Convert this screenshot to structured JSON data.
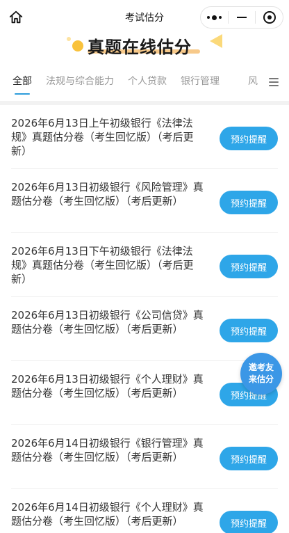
{
  "nav": {
    "title": "考试估分",
    "icons": [
      "home-icon",
      "more-icon",
      "minimize-icon",
      "target-icon"
    ]
  },
  "banner": {
    "title": "真题在线估分"
  },
  "tabs": [
    {
      "label": "全部",
      "active": true
    },
    {
      "label": "法规与综合能力",
      "active": false
    },
    {
      "label": "个人贷款",
      "active": false
    },
    {
      "label": "银行管理",
      "active": false
    },
    {
      "label": "风",
      "active": false
    }
  ],
  "items": [
    {
      "title": "2026年6月13日上午初级银行《法律法规》真题估分卷（考生回忆版）（考后更新）",
      "button": "预约提醒"
    },
    {
      "title": "2026年6月13日初级银行《风险管理》真题估分卷（考生回忆版）（考后更新）",
      "button": "预约提醒"
    },
    {
      "title": "2026年6月13日下午初级银行《法律法规》真题估分卷（考生回忆版）（考后更新）",
      "button": "预约提醒"
    },
    {
      "title": "2026年6月13日初级银行《公司信贷》真题估分卷（考生回忆版）（考后更新）",
      "button": "预约提醒"
    },
    {
      "title": "2026年6月13日初级银行《个人理财》真题估分卷（考生回忆版）（考后更新）",
      "button": "预约提醒"
    },
    {
      "title": "2026年6月14日初级银行《银行管理》真题估分卷（考生回忆版）（考后更新）",
      "button": "预约提醒"
    },
    {
      "title": "2026年6月14日初级银行《个人理财》真题估分卷（考生回忆版）（考后更新）",
      "button": "预约提醒"
    }
  ],
  "float": {
    "label": "邀考友来估分"
  },
  "colors": {
    "accent": "#2ea6e8",
    "float_bg": "#3b97e6",
    "underline": "#f7c98a"
  }
}
